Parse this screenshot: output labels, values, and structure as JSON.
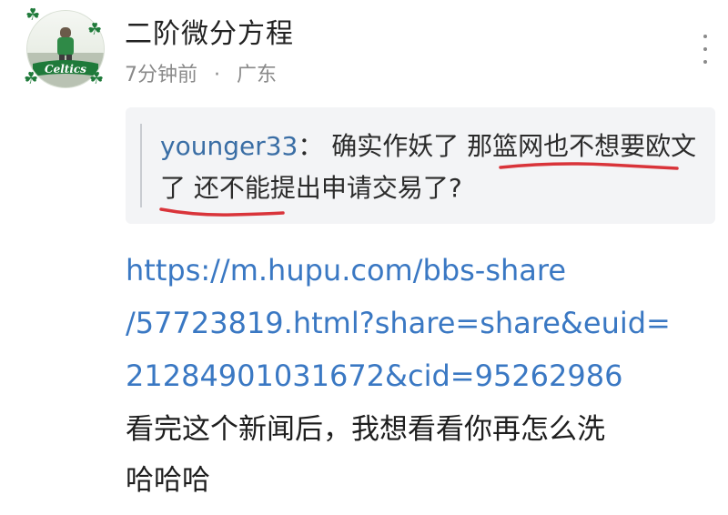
{
  "post": {
    "username": "二阶微分方程",
    "time": "7分钟前",
    "separator": "·",
    "location": "广东",
    "avatar_text": "Celtics"
  },
  "quote": {
    "author": "younger33",
    "colon": "：",
    "text": "确实作妖了 那篮网也不想要欧文了 还不能提出申请交易了?"
  },
  "content": {
    "link_lines": [
      "https://m.hupu.com/bbs-share",
      "/57723819.html?share=share&euid=",
      "21284901031672&cid=95262986"
    ],
    "text_lines": [
      "看完这个新闻后，我想看看你再怎么洗",
      "哈哈哈"
    ]
  },
  "colors": {
    "link": "#3a78c3",
    "quote_author": "#3a6ea5",
    "underline": "#d9343a",
    "meta": "#8a8a8a",
    "quote_bg": "#f3f4f6"
  },
  "icons": {
    "more": "more-vertical-icon",
    "decoration": "clover-icon"
  }
}
